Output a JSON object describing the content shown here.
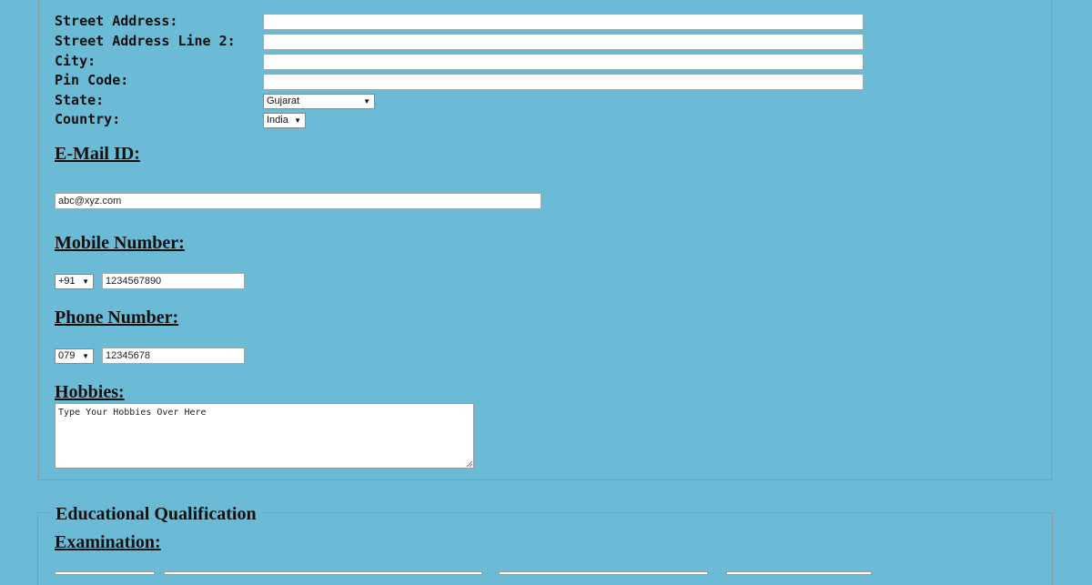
{
  "address": {
    "street_label": "Street Address:",
    "street2_label": "Street Address Line 2:",
    "city_label": "City:",
    "pin_label": "Pin Code:",
    "state_label": "State:",
    "country_label": "Country:",
    "state_value": "Gujarat",
    "country_value": "India"
  },
  "email": {
    "heading": "E-Mail ID:",
    "value": "abc@xyz.com"
  },
  "mobile": {
    "heading": "Mobile Number:",
    "code": "+91",
    "value": "1234567890"
  },
  "phone": {
    "heading": "Phone Number:",
    "code": "079",
    "value": "12345678"
  },
  "hobbies": {
    "heading": "Hobbies:",
    "placeholder": "Type Your Hobbies Over Here"
  },
  "education": {
    "legend": "Educational Qualification",
    "examination_heading": "Examination:"
  },
  "colors": {
    "background": "#6cbbd6",
    "border": "#8a9ba3"
  }
}
